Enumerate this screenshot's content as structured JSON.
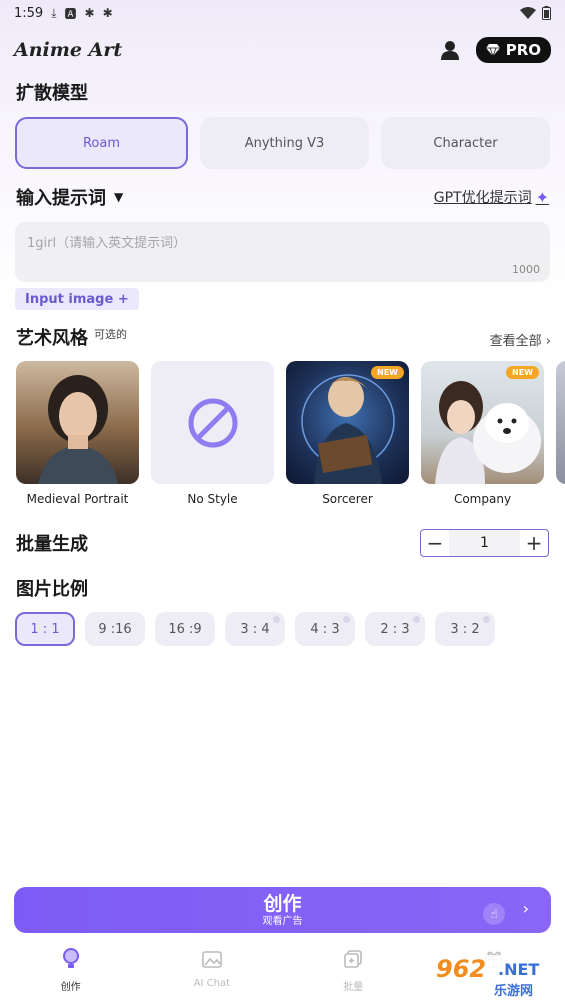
{
  "status_bar": {
    "time": "1:59",
    "icons": [
      "download-icon",
      "a-icon",
      "bug-icon",
      "bug-icon",
      "wifi-icon",
      "battery-icon"
    ]
  },
  "header": {
    "title": "Anime Art",
    "pro_label": "PRO"
  },
  "model_section": {
    "title": "扩散模型",
    "models": [
      {
        "label": "Roam",
        "active": true
      },
      {
        "label": "Anything V3",
        "active": false
      },
      {
        "label": "Character",
        "active": false
      }
    ]
  },
  "prompt_section": {
    "title": "输入提示词",
    "gpt_link": "GPT优化提示词",
    "placeholder": "1girl（请输入英文提示词）",
    "value": "",
    "char_limit": "1000",
    "input_image_label": "Input image +"
  },
  "style_section": {
    "title": "艺术风格",
    "optional": "可选的",
    "see_all": "查看全部 ›",
    "styles": [
      {
        "label": "Medieval Portrait",
        "badge": ""
      },
      {
        "label": "No Style",
        "badge": ""
      },
      {
        "label": "Sorcerer",
        "badge": "NEW"
      },
      {
        "label": "Company",
        "badge": "NEW"
      }
    ]
  },
  "batch_section": {
    "title": "批量生成",
    "count": "1"
  },
  "ratio_section": {
    "title": "图片比例",
    "ratios": [
      {
        "label": "1 : 1",
        "active": true,
        "locked": false
      },
      {
        "label": "9 :16",
        "active": false,
        "locked": false
      },
      {
        "label": "16 :9",
        "active": false,
        "locked": false
      },
      {
        "label": "3 : 4",
        "active": false,
        "locked": true
      },
      {
        "label": "4 : 3",
        "active": false,
        "locked": true
      },
      {
        "label": "2 : 3",
        "active": false,
        "locked": true
      },
      {
        "label": "3 : 2",
        "active": false,
        "locked": true
      }
    ]
  },
  "create_button": {
    "label": "创作",
    "sub_label": "观看广告"
  },
  "bottom_nav": [
    {
      "label": "创作",
      "icon": "bulb-icon",
      "active": true
    },
    {
      "label": "AI Chat",
      "icon": "image-icon",
      "active": false
    },
    {
      "label": "批量",
      "icon": "layers-icon",
      "active": false
    },
    {
      "label": "",
      "icon": "gift-icon",
      "active": false
    }
  ],
  "watermark": {
    "number": "962",
    "domain": ".NET",
    "site_name": "乐游网"
  },
  "colors": {
    "accent": "#7d5cf5",
    "active_border": "#7a6ad8",
    "badge": "#f5a623"
  }
}
